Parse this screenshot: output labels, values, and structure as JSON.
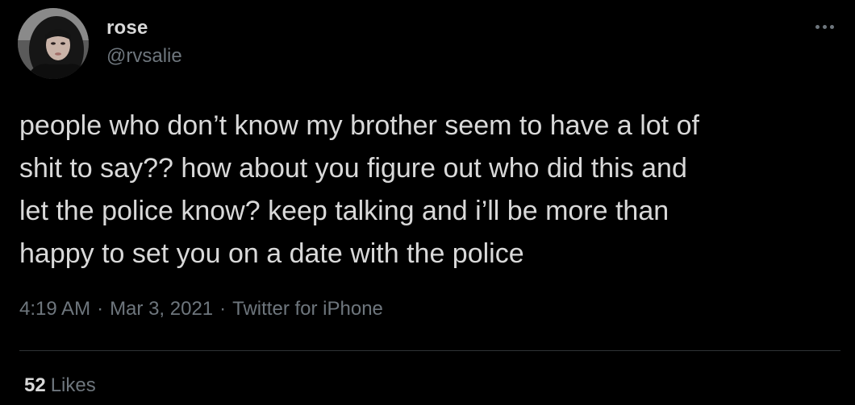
{
  "author": {
    "name": "rose",
    "handle": "@rvsalie"
  },
  "tweet": {
    "text": "people who don’t know my brother seem to have a lot of\nshit to say?? how about you figure out who did this and\nlet the police know? keep talking and i’ll be more than\nhappy to set you on a date with the police",
    "time": "4:19 AM",
    "separator": "·",
    "date": "Mar 3, 2021",
    "source": "Twitter for iPhone"
  },
  "stats": {
    "likes_count": "52",
    "likes_label": "Likes"
  },
  "icons": {
    "more": "more-dots-icon"
  },
  "colors": {
    "background": "#000000",
    "primary_text": "#d9d9d9",
    "secondary_text": "#6e767d",
    "divider": "#2f3336"
  }
}
